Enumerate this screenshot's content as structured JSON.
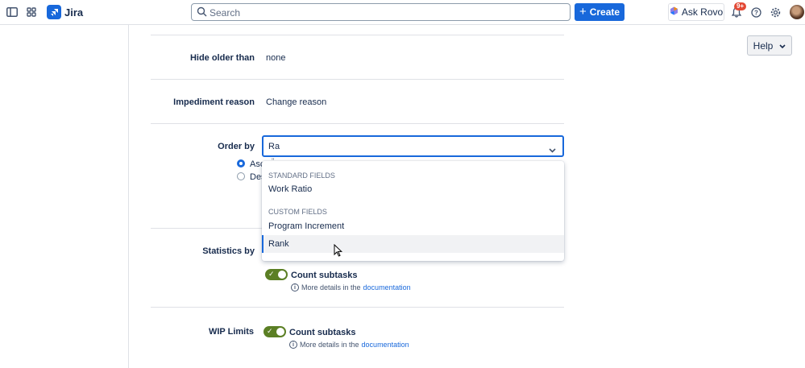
{
  "topbar": {
    "app_name": "Jira",
    "search_placeholder": "Search",
    "create_label": "Create",
    "ask_rovo_label": "Ask Rovo",
    "notification_badge": "9+"
  },
  "help_label": "Help",
  "form": {
    "hide_older_than": {
      "label": "Hide older than",
      "value": "none"
    },
    "impediment_reason": {
      "label": "Impediment reason",
      "value": "Change reason"
    },
    "order_by": {
      "label": "Order by",
      "input_value": "Ra",
      "radio_ascending_partial": "Asc",
      "radio_descending_partial": "Des",
      "radio_partial_tail": "''"
    },
    "statistics_by": {
      "label": "Statistics by",
      "toggle_label": "Count subtasks",
      "info_text": "More details in the",
      "info_link": "documentation"
    },
    "wip_limits": {
      "label": "WIP Limits",
      "toggle_label": "Count subtasks",
      "info_text": "More details in the",
      "info_link": "documentation"
    }
  },
  "dropdown": {
    "groups": [
      {
        "heading": "STANDARD FIELDS",
        "items": [
          "Work Ratio"
        ]
      },
      {
        "heading": "CUSTOM FIELDS",
        "items": [
          "Program Increment",
          "Rank"
        ]
      }
    ],
    "hovered_item": "Rank"
  },
  "colors": {
    "accent": "#1868db",
    "toggle_on": "#5b7f24",
    "badge": "#e34935"
  }
}
